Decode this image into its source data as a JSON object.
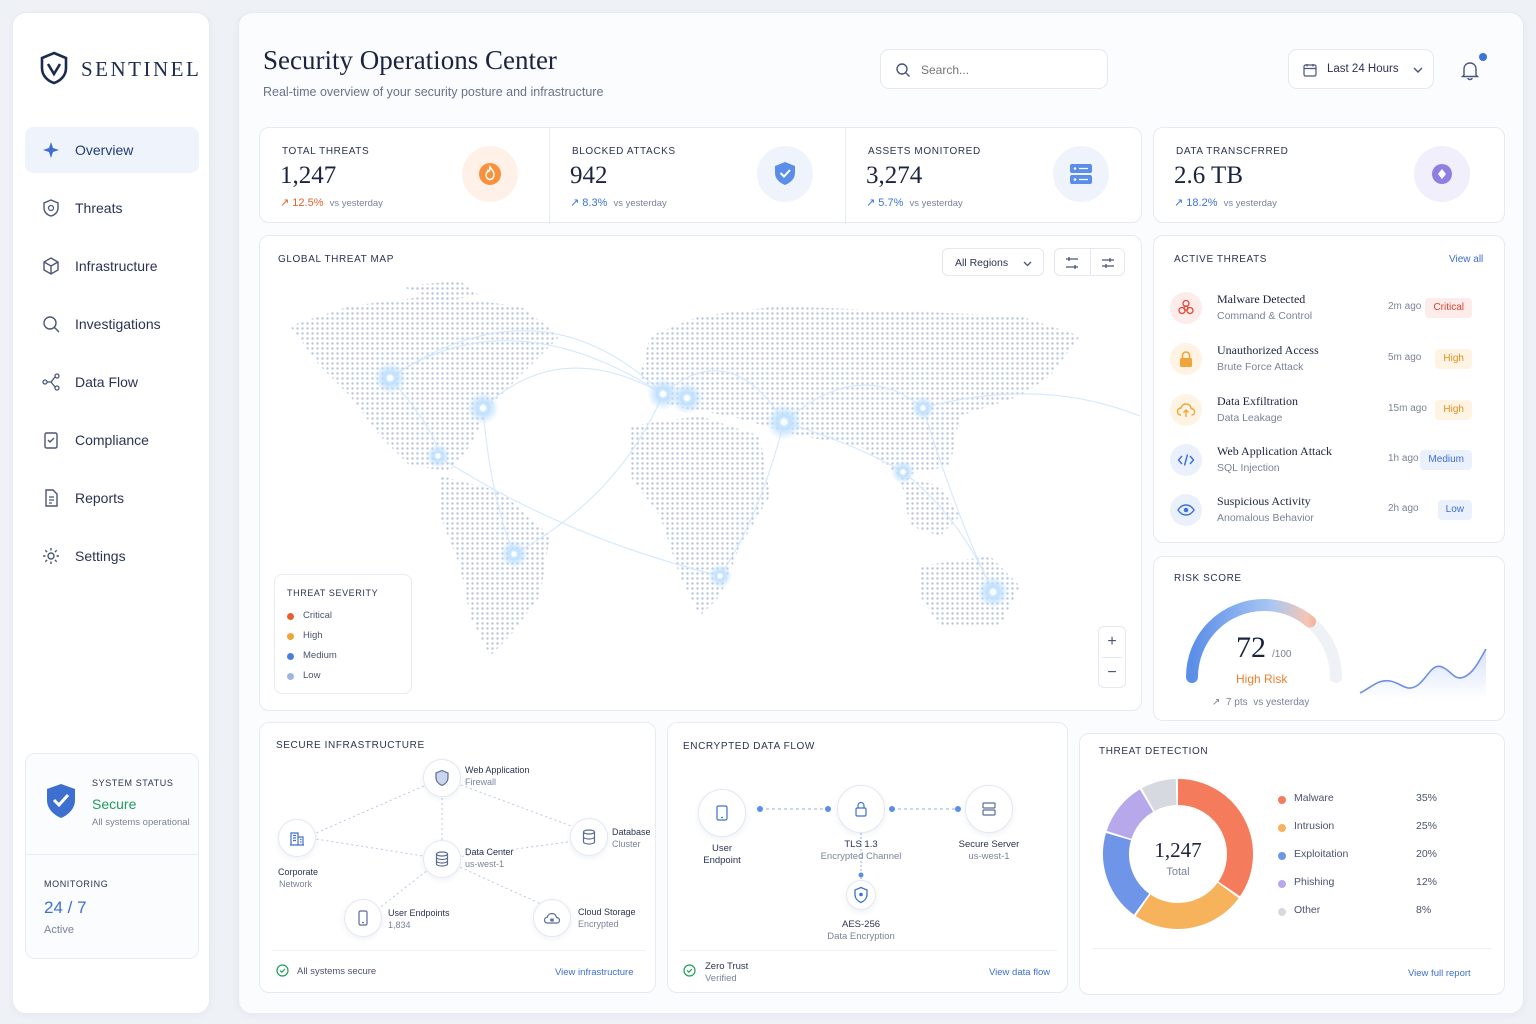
{
  "brand": {
    "name": "SENTINEL"
  },
  "nav": {
    "items": [
      {
        "label": "Overview",
        "icon": "overview-icon",
        "active": true
      },
      {
        "label": "Threats",
        "icon": "shield-icon"
      },
      {
        "label": "Infrastructure",
        "icon": "cube-icon"
      },
      {
        "label": "Investigations",
        "icon": "search-icon"
      },
      {
        "label": "Data Flow",
        "icon": "flow-icon"
      },
      {
        "label": "Compliance",
        "icon": "clipboard-icon"
      },
      {
        "label": "Reports",
        "icon": "document-icon"
      },
      {
        "label": "Settings",
        "icon": "gear-icon"
      }
    ]
  },
  "system_status": {
    "label": "SYSTEM STATUS",
    "value": "Secure",
    "detail": "All systems operational"
  },
  "monitoring": {
    "label": "MONITORING",
    "value": "24 / 7",
    "detail": "Active"
  },
  "header": {
    "title": "Security Operations Center",
    "subtitle": "Real-time overview of your security posture and infrastructure",
    "search_placeholder": "Search...",
    "date_range": "Last 24 Hours"
  },
  "kpis": [
    {
      "label": "TOTAL THREATS",
      "value": "1,247",
      "delta": "12.5%",
      "delta_note": "vs yesterday",
      "color": "#e8612c"
    },
    {
      "label": "BLOCKED ATTACKS",
      "value": "942",
      "delta": "8.3%",
      "delta_note": "vs yesterday",
      "color": "#3d74d8"
    },
    {
      "label": "ASSETS MONITORED",
      "value": "3,274",
      "delta": "5.7%",
      "delta_note": "vs yesterday",
      "color": "#3d74d8"
    },
    {
      "label": "DATA TRANSCFRRED",
      "value": "2.6 TB",
      "delta": "18.2%",
      "delta_note": "vs yesterday",
      "color": "#3d74d8"
    }
  ],
  "threat_map": {
    "title": "GLOBAL THREAT MAP",
    "region_select": "All Regions",
    "severity_title": "THREAT SEVERITY",
    "severity": [
      {
        "label": "Critical",
        "color": "#e8612c"
      },
      {
        "label": "High",
        "color": "#f0a53a"
      },
      {
        "label": "Medium",
        "color": "#4a7fe0"
      },
      {
        "label": "Low",
        "color": "#9fb4e0"
      }
    ],
    "zoom_in": "+",
    "zoom_out": "−"
  },
  "active_threats": {
    "title": "ACTIVE THREATS",
    "view_all": "View all",
    "items": [
      {
        "name": "Malware Detected",
        "type": "Command & Control",
        "time": "2m ago",
        "severity": "Critical",
        "icon": "biohazard-icon",
        "color": "#e04a3a",
        "bg": "#fdecea"
      },
      {
        "name": "Unauthorized Access",
        "type": "Brute Force Attack",
        "time": "5m ago",
        "severity": "High",
        "icon": "lock-icon",
        "color": "#f0a53a",
        "bg": "#fff4e4"
      },
      {
        "name": "Data Exfiltration",
        "type": "Data Leakage",
        "time": "15m ago",
        "severity": "High",
        "icon": "cloud-upload-icon",
        "color": "#f0a53a",
        "bg": "#fff4e4"
      },
      {
        "name": "Web Application Attack",
        "type": "SQL Injection",
        "time": "1h ago",
        "severity": "Medium",
        "icon": "code-icon",
        "color": "#3d74d8",
        "bg": "#eaf1fd"
      },
      {
        "name": "Suspicious Activity",
        "type": "Anomalous Behavior",
        "time": "2h ago",
        "severity": "Low",
        "icon": "eye-icon",
        "color": "#3d74d8",
        "bg": "#eaf1fd"
      }
    ]
  },
  "risk_score": {
    "title": "RISK SCORE",
    "value": "72",
    "max": "/100",
    "level": "High Risk",
    "delta": "7 pts",
    "delta_note": "vs yesterday",
    "fraction": 0.72
  },
  "infrastructure": {
    "title": "SECURE INFRASTRUCTURE",
    "nodes": [
      {
        "label": "Web Application",
        "sub": "Firewall"
      },
      {
        "label": "Corporate",
        "sub": "Network"
      },
      {
        "label": "Data Center",
        "sub": "us-west-1"
      },
      {
        "label": "Database",
        "sub": "Cluster"
      },
      {
        "label": "User Endpoints",
        "sub": "1,834"
      },
      {
        "label": "Cloud Storage",
        "sub": "Encrypted"
      }
    ],
    "status": "All systems secure",
    "link": "View infrastructure"
  },
  "data_flow": {
    "title": "ENCRYPTED DATA FLOW",
    "nodes": [
      {
        "label": "User",
        "sub": "Endpoint"
      },
      {
        "label": "TLS 1.3",
        "sub": "Encrypted Channel"
      },
      {
        "label": "Secure Server",
        "sub": "us-west-1"
      },
      {
        "label": "AES-256",
        "sub": "Data Encryption"
      }
    ],
    "status": "Zero Trust",
    "status_sub": "Verified",
    "link": "View data flow"
  },
  "threat_detection": {
    "title": "THREAT DETECTION",
    "total": "1,247",
    "total_label": "Total",
    "link": "View full report",
    "chart_data": {
      "type": "pie",
      "categories": [
        "Malware",
        "Intrusion",
        "Exploitation",
        "Phishing",
        "Other"
      ],
      "values": [
        35,
        25,
        20,
        12,
        8
      ],
      "labels": [
        "35%",
        "25%",
        "20%",
        "12%",
        "8%"
      ],
      "colors": [
        "#f47c5c",
        "#f7b25c",
        "#6f95e8",
        "#b7a8ec",
        "#d6d9e0"
      ]
    }
  }
}
